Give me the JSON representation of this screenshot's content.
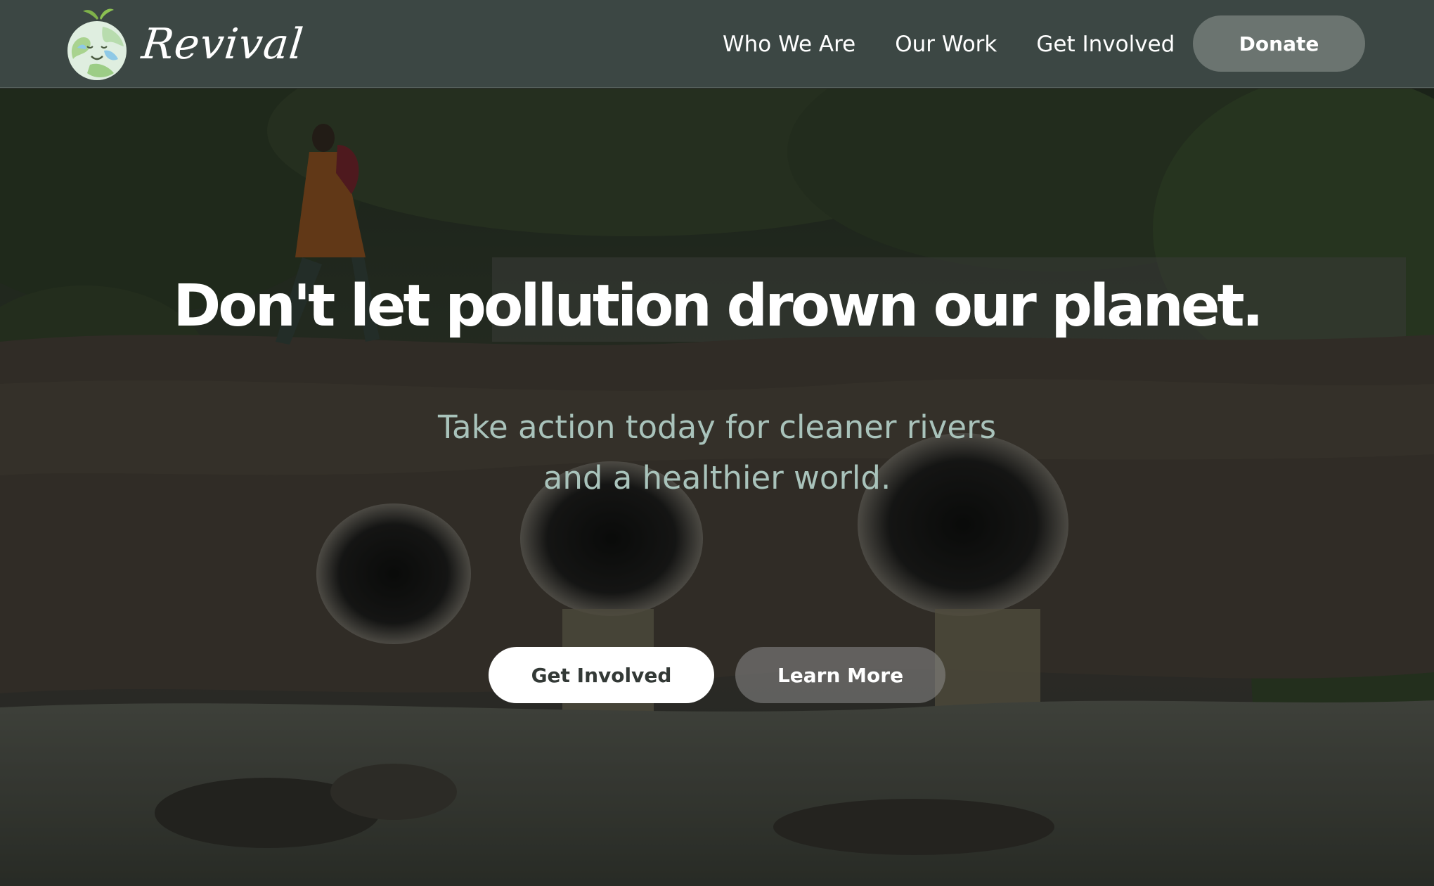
{
  "brand": {
    "name": "Revival",
    "logo_icon": "earth-globe-icon"
  },
  "nav": {
    "links": [
      {
        "label": "Who We Are"
      },
      {
        "label": "Our Work"
      },
      {
        "label": "Get Involved"
      }
    ],
    "donate_label": "Donate"
  },
  "hero": {
    "title": "Don't let pollution drown our planet.",
    "subtitle_line1": "Take action today for cleaner rivers",
    "subtitle_line2": "and a healthier world.",
    "primary_cta": "Get Involved",
    "secondary_cta": "Learn More",
    "background_image": "polluted-river-with-drainage-pipes"
  },
  "colors": {
    "nav_bg": "#3c4744",
    "donate_bg": "#6b7470",
    "subtitle": "#a9c3bb",
    "primary_btn_bg": "#ffffff",
    "primary_btn_text": "#333936"
  }
}
